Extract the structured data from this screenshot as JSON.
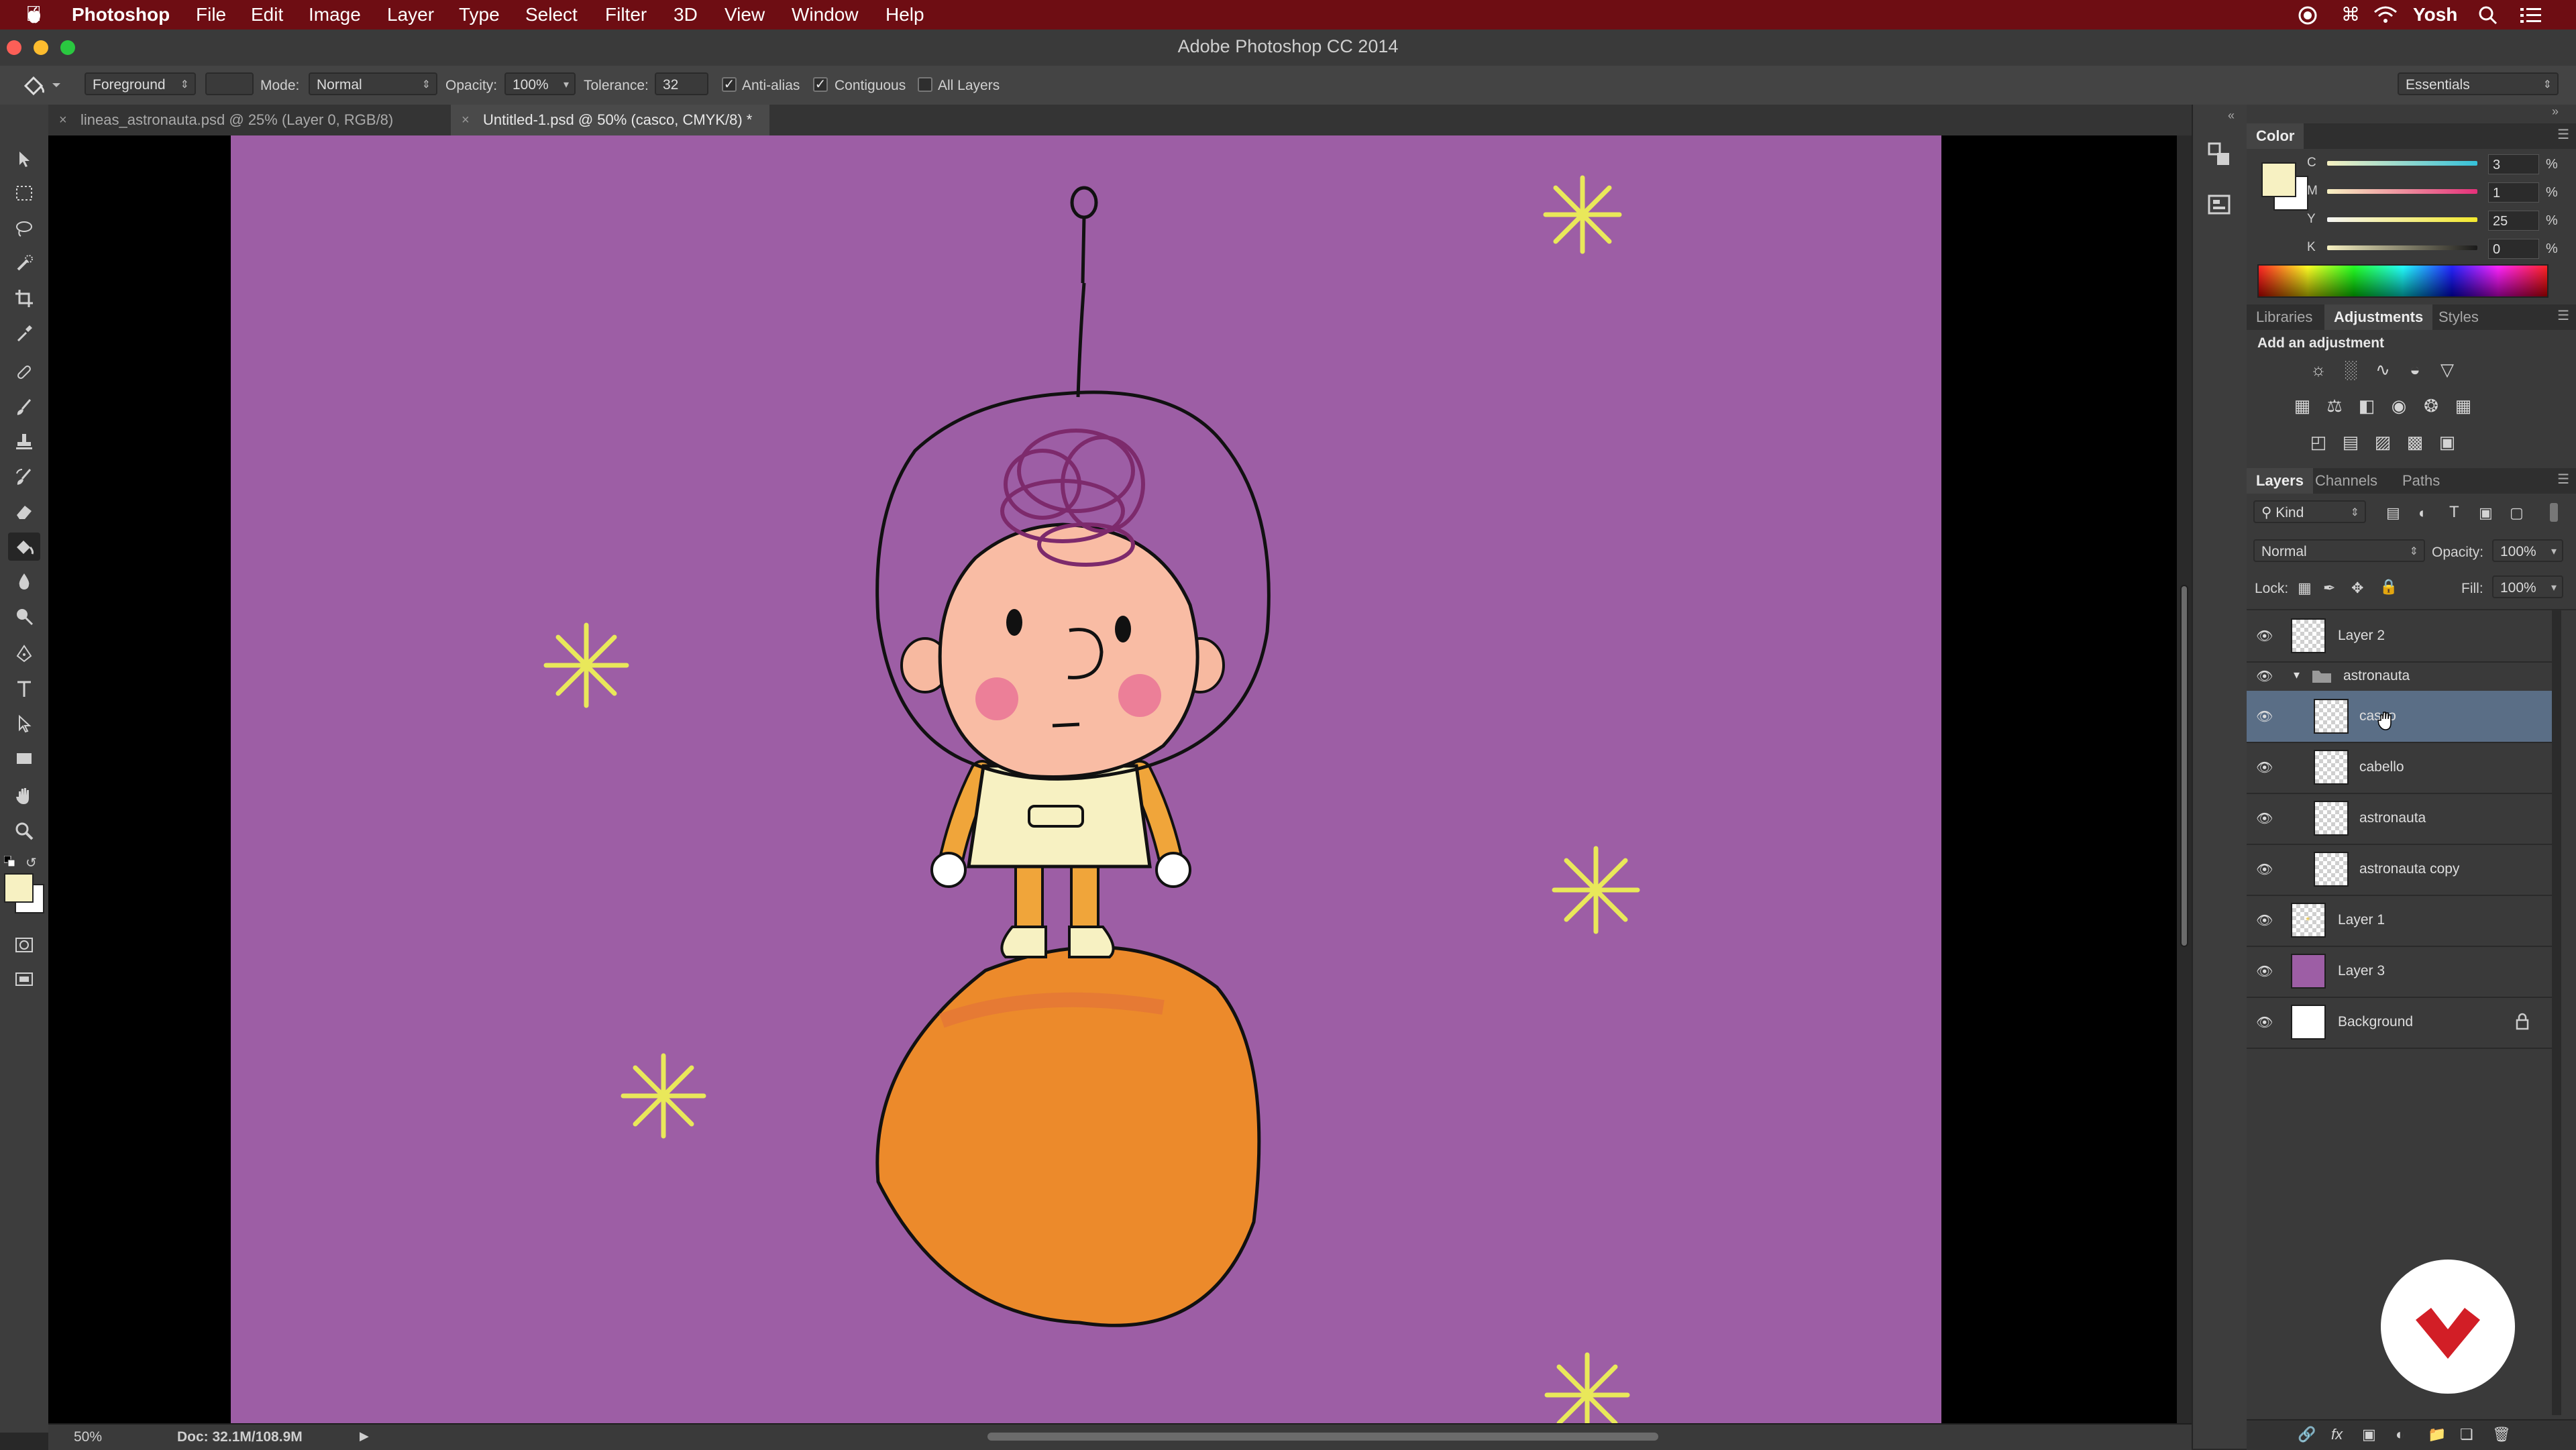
{
  "menubar": {
    "app_name": "Photoshop",
    "items": [
      "File",
      "Edit",
      "Image",
      "Layer",
      "Type",
      "Select",
      "Filter",
      "3D",
      "View",
      "Window",
      "Help"
    ],
    "user": "Yosh"
  },
  "window": {
    "title": "Adobe Photoshop CC 2014"
  },
  "options": {
    "fill_source": "Foreground",
    "mode_label": "Mode:",
    "mode_value": "Normal",
    "opacity_label": "Opacity:",
    "opacity_value": "100%",
    "tolerance_label": "Tolerance:",
    "tolerance_value": "32",
    "anti_alias_label": "Anti-alias",
    "contiguous_label": "Contiguous",
    "all_layers_label": "All Layers",
    "workspace": "Essentials"
  },
  "tabs": [
    {
      "label": "lineas_astronauta.psd @ 25% (Layer 0, RGB/8)"
    },
    {
      "label": "Untitled-1.psd @ 50% (casco, CMYK/8) *"
    }
  ],
  "status": {
    "zoom": "50%",
    "doc": "Doc: 32.1M/108.9M"
  },
  "color_panel": {
    "title": "Color",
    "channels": [
      {
        "label": "C",
        "value": "3",
        "unit": "%"
      },
      {
        "label": "M",
        "value": "1",
        "unit": "%"
      },
      {
        "label": "Y",
        "value": "25",
        "unit": "%"
      },
      {
        "label": "K",
        "value": "0",
        "unit": "%"
      }
    ],
    "foreground": "#f7f1c2",
    "background": "#ffffff"
  },
  "adjust_panel": {
    "tabs": [
      "Libraries",
      "Adjustments",
      "Styles"
    ],
    "active_tab": "Adjustments",
    "heading": "Add an adjustment"
  },
  "layers_panel": {
    "tabs": [
      "Layers",
      "Channels",
      "Paths"
    ],
    "filter": "Kind",
    "blend_mode": "Normal",
    "opacity_label": "Opacity:",
    "opacity_value": "100%",
    "lock_label": "Lock:",
    "fill_label": "Fill:",
    "fill_value": "100%",
    "layers": [
      {
        "name": "Layer 2"
      },
      {
        "name": "astronauta"
      },
      {
        "name": "casco"
      },
      {
        "name": "cabello"
      },
      {
        "name": "astronauta"
      },
      {
        "name": "astronauta copy"
      },
      {
        "name": "Layer 1"
      },
      {
        "name": "Layer 3"
      },
      {
        "name": "Background"
      }
    ]
  },
  "colors": {
    "canvas_bg": "#9d5ea5",
    "planet": "#ec8a2b",
    "accent_red": "#d21e26",
    "selection": "#5a6e86"
  }
}
